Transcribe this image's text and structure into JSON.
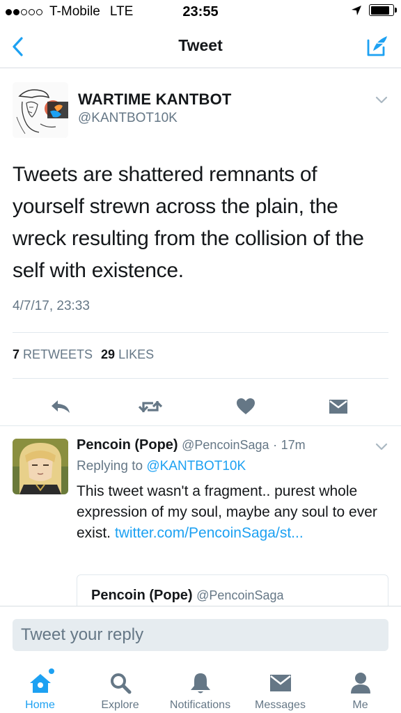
{
  "status_bar": {
    "carrier": "T-Mobile",
    "network": "LTE",
    "time": "23:55",
    "signal_bars_filled": 2,
    "signal_bars_total": 5,
    "battery_level": 0.85
  },
  "nav": {
    "title": "Tweet",
    "back_icon": "chevron-left-icon",
    "compose_icon": "compose-icon",
    "accent_color": "#1da1f2"
  },
  "main_tweet": {
    "author_name": "WARTIME KANTBOT",
    "author_handle": "@KANTBOT10K",
    "text": "Tweets are shattered remnants of yourself strewn across the plain, the wreck resulting from the collision of the self with existence.",
    "timestamp": "4/7/17, 23:33",
    "retweets_count": "7",
    "retweets_label": "RETWEETS",
    "likes_count": "29",
    "likes_label": "LIKES",
    "actions": [
      "reply-icon",
      "retweet-icon",
      "like-icon",
      "dm-icon"
    ]
  },
  "reply_tweet": {
    "author_name": "Pencoin (Pope)",
    "author_handle": "@PencoinSaga",
    "separator": "·",
    "age": "17m",
    "replying_prefix": "Replying to",
    "replying_handle": "@KANTBOT10K",
    "text": "This tweet wasn't a fragment.. purest whole expression of my soul, maybe any soul to ever exist.",
    "link_text": "twitter.com/PencoinSaga/st...",
    "quote": {
      "author_name": "Pencoin (Pope)",
      "author_handle": "@PencoinSaga"
    }
  },
  "composer": {
    "placeholder": "Tweet your reply"
  },
  "tabs": [
    {
      "label": "Home",
      "icon": "home-icon",
      "active": true
    },
    {
      "label": "Explore",
      "icon": "search-icon",
      "active": false
    },
    {
      "label": "Notifications",
      "icon": "bell-icon",
      "active": false
    },
    {
      "label": "Messages",
      "icon": "envelope-icon",
      "active": false
    },
    {
      "label": "Me",
      "icon": "person-icon",
      "active": false
    }
  ]
}
